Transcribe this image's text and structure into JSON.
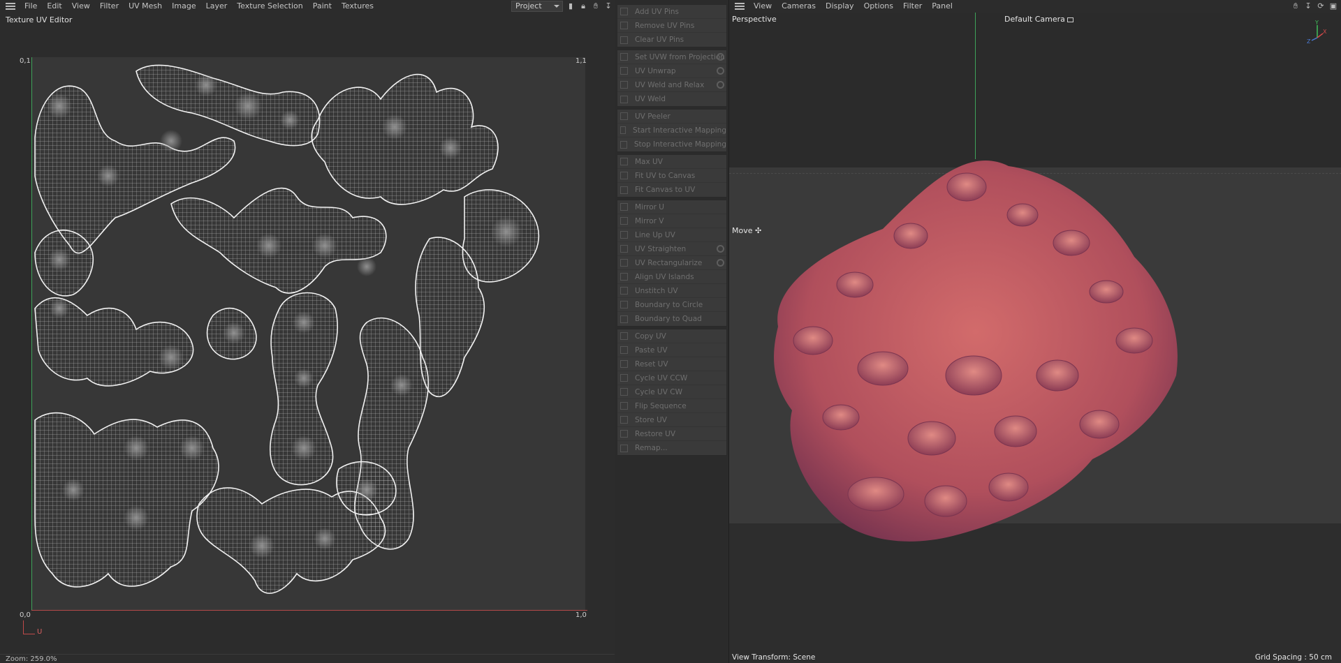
{
  "left_panel": {
    "menu": [
      "File",
      "Edit",
      "View",
      "Filter",
      "UV Mesh",
      "Image",
      "Layer",
      "Texture Selection",
      "Paint",
      "Textures"
    ],
    "project_select": "Project",
    "title": "Texture UV Editor",
    "coords": {
      "top_left": "0,1",
      "top_right": "1,1",
      "bottom_left": "0,0",
      "bottom_right": "1,0"
    },
    "u_axis_label": "U",
    "zoom": "Zoom: 259.0%"
  },
  "tool_groups": [
    [
      "Add UV Pins",
      "Remove UV Pins",
      "Clear UV Pins"
    ],
    [
      "Set UVW from Projection",
      "UV Unwrap",
      "UV Weld and Relax",
      "UV Weld"
    ],
    [
      "UV Peeler",
      "Start Interactive Mapping",
      "Stop Interactive Mapping"
    ],
    [
      "Max UV",
      "Fit UV to Canvas",
      "Fit Canvas to UV"
    ],
    [
      "Mirror U",
      "Mirror V",
      "Line Up UV",
      "UV Straighten",
      "UV Rectangularize",
      "Align UV Islands",
      "Unstitch UV",
      "Boundary to Circle",
      "Boundary to Quad"
    ],
    [
      "Copy UV",
      "Paste UV",
      "Reset UV",
      "Cycle UV CCW",
      "Cycle UV CW",
      "Flip Sequence",
      "Store UV",
      "Restore UV",
      "Remap..."
    ]
  ],
  "right_panel": {
    "menu": [
      "View",
      "Cameras",
      "Display",
      "Options",
      "Filter",
      "Panel"
    ],
    "view_name": "Perspective",
    "camera": "Default Camera",
    "tool": "Move",
    "view_transform": "View Transform: Scene",
    "grid_spacing": "Grid Spacing : 50 cm",
    "gizmo": {
      "y": "Y",
      "x": "X",
      "z": "Z"
    }
  }
}
